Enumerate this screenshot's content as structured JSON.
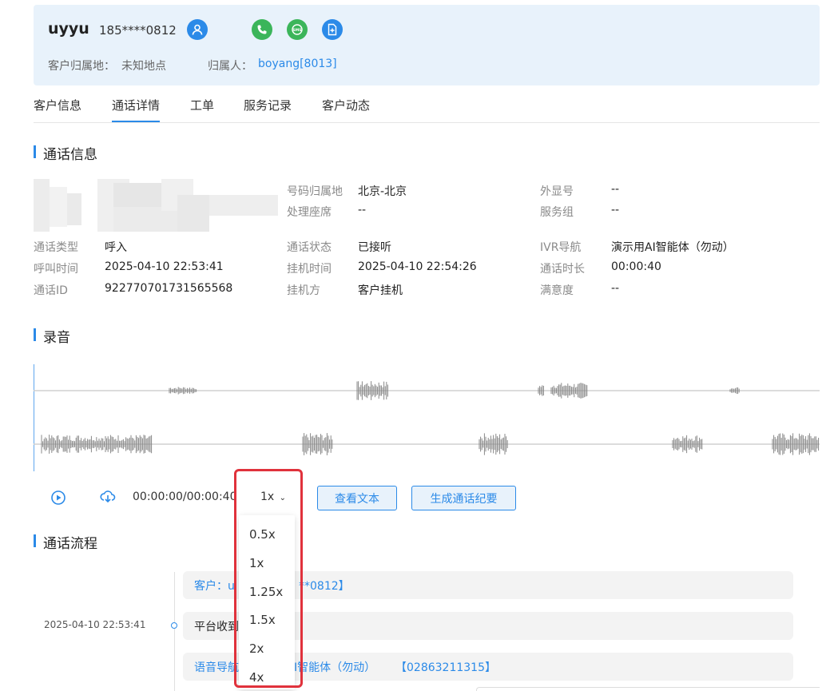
{
  "customer": {
    "name": "uyyu",
    "phone": "185****0812",
    "location_label": "客户归属地：",
    "location_value": "未知地点",
    "owner_label": "归属人：",
    "owner_value": "boyang[8013]"
  },
  "tabs": [
    "客户信息",
    "通话详情",
    "工单",
    "服务记录",
    "客户动态"
  ],
  "active_tab": 1,
  "sections": {
    "call_info": "通话信息",
    "recording": "录音",
    "flow": "通话流程"
  },
  "call_info": {
    "number_location_label": "号码归属地",
    "number_location_value": "北京-北京",
    "handler_label": "处理座席",
    "handler_value": "--",
    "display_number_label": "外显号",
    "display_number_value": "--",
    "service_group_label": "服务组",
    "service_group_value": "--",
    "call_type_label": "通话类型",
    "call_type_value": "呼入",
    "call_status_label": "通话状态",
    "call_status_value": "已接听",
    "ivr_label": "IVR导航",
    "ivr_value": "演示用AI智能体（勿动）",
    "call_time_label": "呼叫时间",
    "call_time_value": "2025-04-10 22:53:41",
    "hangup_time_label": "挂机时间",
    "hangup_time_value": "2025-04-10 22:54:26",
    "duration_label": "通话时长",
    "duration_value": "00:00:40",
    "call_id_label": "通话ID",
    "call_id_value": "922770701731565568",
    "hangup_side_label": "挂机方",
    "hangup_side_value": "客户挂机",
    "satisfaction_label": "满意度",
    "satisfaction_value": "--"
  },
  "player": {
    "time": "00:00:00/00:00:40",
    "speed": "1x",
    "speed_options": [
      "0.5x",
      "1x",
      "1.25x",
      "1.5x",
      "2x",
      "4x"
    ],
    "view_text_button": "查看文本",
    "generate_summary_button": "生成通话纪要"
  },
  "flow": {
    "time": "2025-04-10 22:53:41",
    "items": [
      "客户：u",
      "**0812】",
      "平台收到",
      "语音导航",
      "I智能体（勿动）",
      "【02863211315】"
    ]
  },
  "colors": {
    "accent": "#2b8ae8",
    "header_bg": "#e8f2fb",
    "call_green": "#3bb55a",
    "highlight_red": "#e0323c"
  },
  "icons": [
    "user-icon",
    "phone-icon",
    "sms-icon",
    "add-file-icon",
    "play-icon",
    "download-icon",
    "chevron-down-icon"
  ]
}
